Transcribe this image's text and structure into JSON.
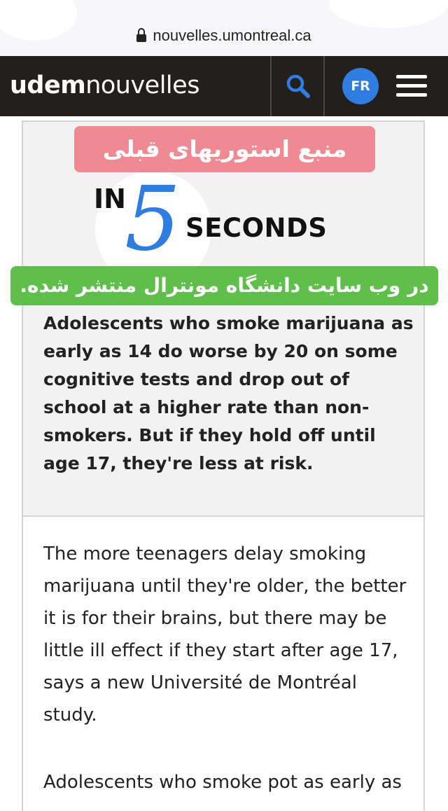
{
  "browser": {
    "url": "nouvelles.umontreal.ca"
  },
  "header": {
    "logo_bold": "udem",
    "logo_light": "nouvelles",
    "lang_button": "FR"
  },
  "summary": {
    "in_label": "IN",
    "five_label": "5",
    "seconds_label": "SECONDS",
    "text": "Adolescents who smoke marijuana as early as 14 do worse by 20 on some cognitive tests and drop out of school at a higher rate than non-smokers. But if they hold off until age 17, they're less at risk."
  },
  "overlays": {
    "top_banner": "منبع استوریهای قبلی",
    "bottom_banner": "در وب سایت دانشگاه مونترال منتشر شده."
  },
  "article": {
    "paragraph1": "The more teenagers delay smoking marijuana until they're older, the better it is for their brains, but there may be little ill effect if they start after age 17, says a new Université de Montréal study.",
    "paragraph2": "Adolescents who smoke pot as early as"
  },
  "colors": {
    "header_bg": "#231f1c",
    "accent_blue": "#2f7de1",
    "pink_banner": "#ef8a93",
    "green_banner": "#5fbf4b"
  }
}
